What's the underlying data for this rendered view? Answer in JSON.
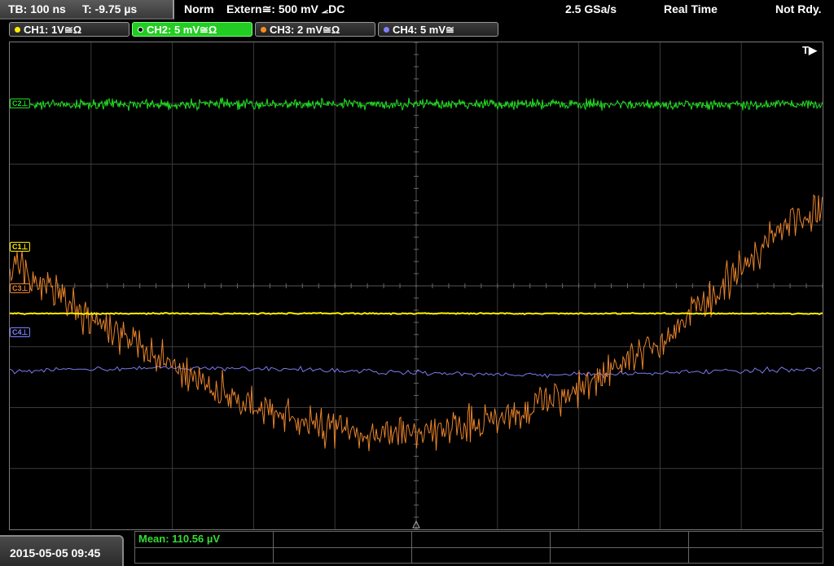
{
  "status": {
    "timebase": "TB: 100 ns",
    "trigger_time": "T: -9.75 µs",
    "mode": "Norm",
    "trigger_source": "Extern≅: 500 mV ⦟DC",
    "sample_rate": "2.5 GSa/s",
    "acq_mode": "Real Time",
    "state": "Not Rdy."
  },
  "channels": [
    {
      "label": "CH1: 1V≅Ω",
      "color": "#ffee00",
      "active": false
    },
    {
      "label": "CH2: 5 mV≅Ω",
      "color": "#22dd22",
      "active": true
    },
    {
      "label": "CH3: 2 mV≅Ω",
      "color": "#ff8c1a",
      "active": false
    },
    {
      "label": "CH4: 5 mV≅",
      "color": "#8080ff",
      "active": false
    }
  ],
  "markers": {
    "c1": "C1⊥",
    "c2": "C2⊥",
    "c3": "C3⊥",
    "c4": "C4⊥",
    "trigger": "T▶"
  },
  "measurement": {
    "mean": "Mean: 110.56 µV"
  },
  "datetime": "2015-05-05 09:45",
  "colors": {
    "ch1": "#ffee00",
    "ch2": "#22dd22",
    "ch3": "#e8832a",
    "ch4": "#7a7aee",
    "grid": "#3a3a3a"
  }
}
